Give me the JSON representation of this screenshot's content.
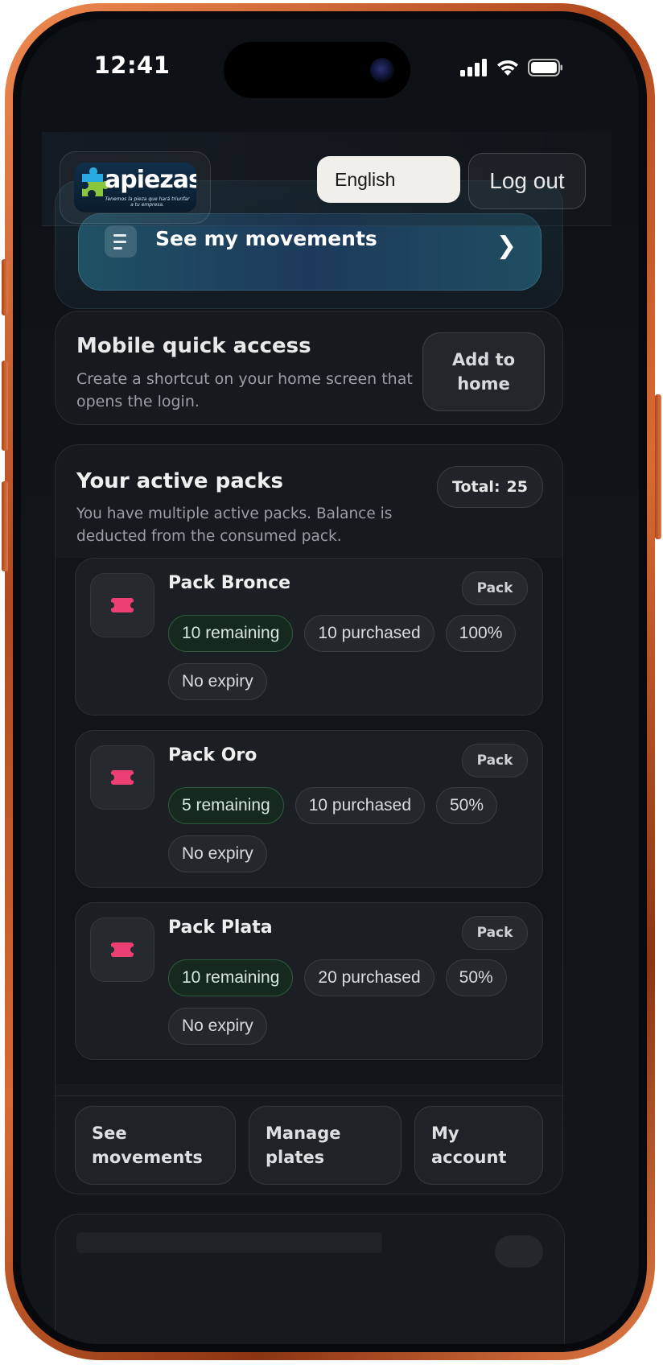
{
  "status_bar": {
    "time": "12:41"
  },
  "header": {
    "logo": {
      "word": "apiezas",
      "tagline": "Tenemos la pieza que hará triunfar a tu empresa."
    },
    "language_select": "English",
    "logout_label": "Log out"
  },
  "movements": {
    "label": "See my movements"
  },
  "quick_access": {
    "title": "Mobile quick access",
    "description": "Create a shortcut on your home screen that opens the login.",
    "button_label": "Add to home"
  },
  "packs": {
    "title": "Your active packs",
    "description": "You have multiple active packs. Balance is deducted from the consumed pack.",
    "total_label": "Total:",
    "total_value": "25",
    "items": [
      {
        "name": "Pack Bronce",
        "tag": "Pack",
        "remaining": "10 remaining",
        "purchased": "10 purchased",
        "percent": "100%",
        "expiry": "No expiry"
      },
      {
        "name": "Pack Oro",
        "tag": "Pack",
        "remaining": "5 remaining",
        "purchased": "10 purchased",
        "percent": "50%",
        "expiry": "No expiry"
      },
      {
        "name": "Pack Plata",
        "tag": "Pack",
        "remaining": "10 remaining",
        "purchased": "20 purchased",
        "percent": "50%",
        "expiry": "No expiry"
      }
    ],
    "actions": [
      "See movements",
      "Manage plates",
      "My account"
    ]
  },
  "colors": {
    "accent_pink": "#ec3f73",
    "remaining_green": "#16291f",
    "frame_orange": "#d86a34"
  }
}
